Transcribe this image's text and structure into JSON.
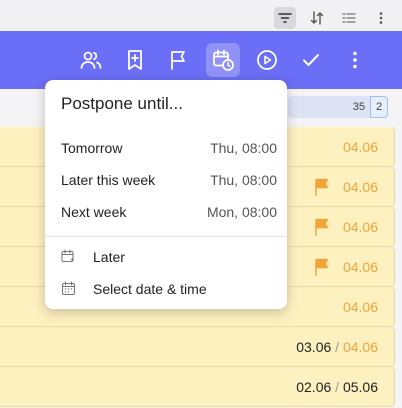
{
  "mini_toolbar": {
    "icons": [
      "filter-icon",
      "sort-icon",
      "list-view-icon",
      "more-vertical-icon"
    ]
  },
  "action_bar": {
    "icons": [
      "assign-user-icon",
      "add-bookmark-icon",
      "flag-icon",
      "postpone-icon",
      "start-icon",
      "complete-icon",
      "more-vertical-icon"
    ],
    "accent": "#6b6ef6"
  },
  "list_header": {
    "count": "35",
    "count_secondary": "2"
  },
  "rows": [
    {
      "start": "",
      "due": "04.06",
      "flag": false
    },
    {
      "start": "",
      "due": "04.06",
      "flag": true
    },
    {
      "start": "",
      "due": "04.06",
      "flag": true
    },
    {
      "start": "",
      "due": "04.06",
      "flag": true
    },
    {
      "start": "",
      "due": "04.06",
      "flag": false
    },
    {
      "start": "03.06",
      "due": "04.06",
      "flag": false
    },
    {
      "start": "02.06",
      "due": "05.06",
      "flag": false
    }
  ],
  "colors": {
    "row_bg": "#fdf1c0",
    "due_date": "#f0a43a",
    "flag": "#f0a43a"
  },
  "popup": {
    "title": "Postpone until...",
    "items": [
      {
        "label": "Tomorrow",
        "value": "Thu, 08:00"
      },
      {
        "label": "Later this week",
        "value": "Thu, 08:00"
      },
      {
        "label": "Next week",
        "value": "Mon, 08:00"
      }
    ],
    "later_label": "Later",
    "select_label": "Select date & time"
  }
}
